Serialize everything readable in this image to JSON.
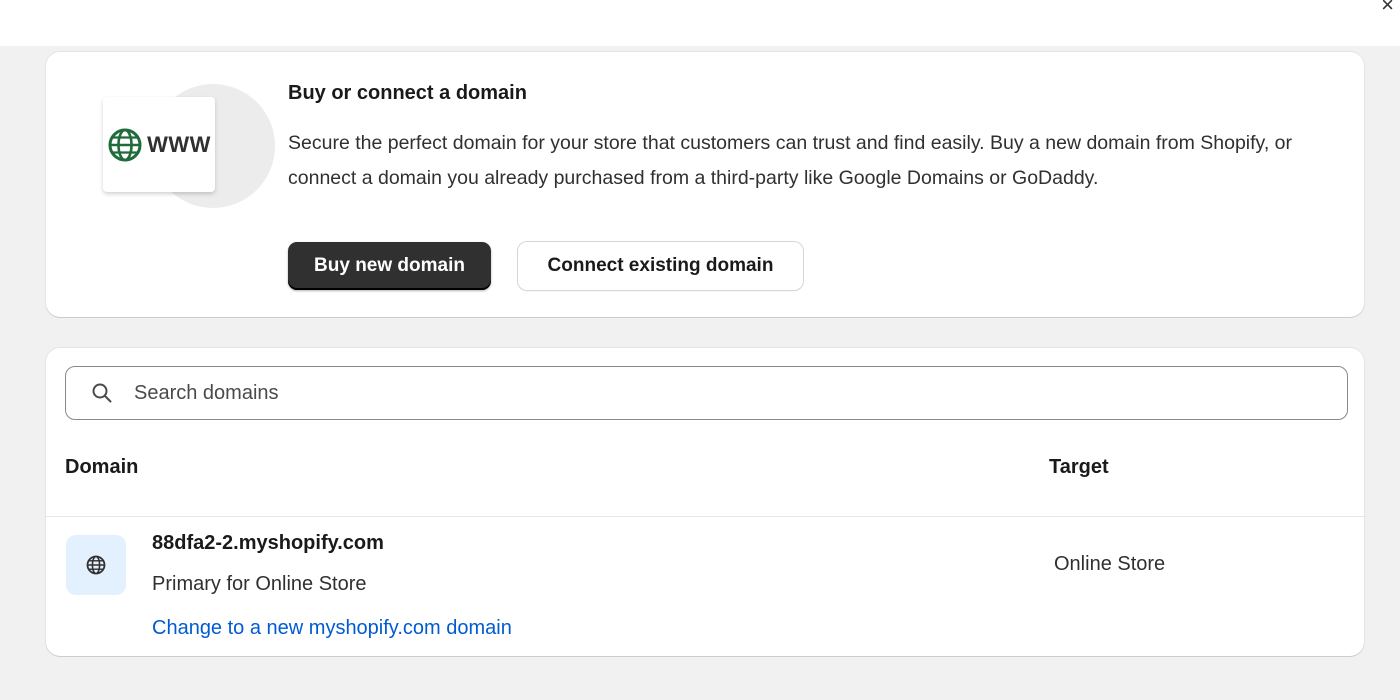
{
  "modal": {
    "close_label": "×"
  },
  "promo": {
    "illustration_text": "WWW",
    "illustration_icon": "globe-icon",
    "title": "Buy or connect a domain",
    "description": "Secure the perfect domain for your store that customers can trust and find easily. Buy a new domain from Shopify, or connect a domain you already purchased from a third-party like Google Domains or GoDaddy.",
    "primary_button": "Buy new domain",
    "secondary_button": "Connect existing domain"
  },
  "search": {
    "placeholder": "Search domains",
    "icon": "search-icon"
  },
  "table": {
    "columns": {
      "domain": "Domain",
      "target": "Target"
    },
    "rows": [
      {
        "icon": "globe-icon",
        "domain": "88dfa2-2.myshopify.com",
        "status": "Primary for Online Store",
        "link": "Change to a new myshopify.com domain",
        "target": "Online Store"
      }
    ]
  },
  "colors": {
    "primary_button_bg": "#303030",
    "link": "#005bd3",
    "globe_green": "#1f6b3a",
    "row_icon_bg": "#e3f0fd"
  }
}
